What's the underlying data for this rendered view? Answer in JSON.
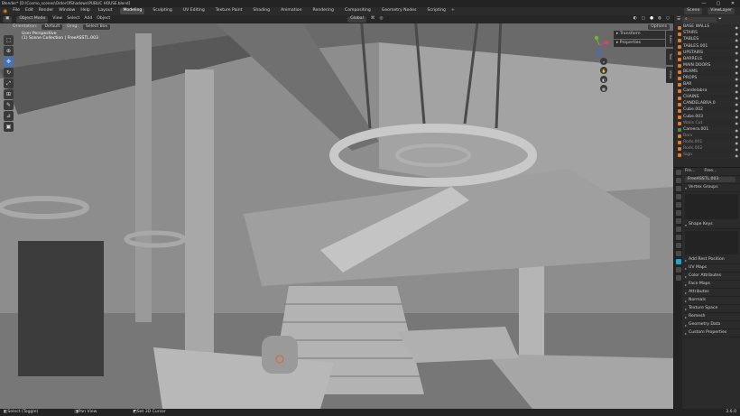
{
  "app": {
    "title": "Blender* [D:\\Cosmo_scenes\\OrderOfShadows\\PUBLIC HOUSE.blend]",
    "window_controls": [
      "—",
      "▢",
      "✕"
    ]
  },
  "menu": {
    "items": [
      "File",
      "Edit",
      "Render",
      "Window",
      "Help"
    ],
    "workspaces": [
      "Layout",
      "Modeling",
      "Sculpting",
      "UV Editing",
      "Texture Paint",
      "Shading",
      "Animation",
      "Rendering",
      "Compositing",
      "Geometry Nodes",
      "Scripting"
    ],
    "active_workspace": "Modeling",
    "scene": "Scene",
    "view_layer": "ViewLayer"
  },
  "viewport": {
    "mode": "Object Mode",
    "view_menus": [
      "View",
      "Select",
      "Add",
      "Object"
    ],
    "orientation": "Global",
    "sub": {
      "orientation_label": "Orientation:",
      "orientation_value": "Default",
      "drag_label": "Drag:",
      "drag_value": "Select Box",
      "options": "Options"
    },
    "info_line1": "User Perspective",
    "info_line2": "(1) Scene Collection | FreeASSTL.003"
  },
  "npanel": {
    "sections": [
      "Transform",
      "Properties"
    ],
    "tabs": [
      "Item",
      "Tool",
      "View"
    ]
  },
  "outliner": {
    "items": [
      {
        "name": "BASE WALLS",
        "type": "obj",
        "selected": false,
        "dim": false
      },
      {
        "name": "STAIRS",
        "type": "obj",
        "selected": false,
        "dim": false
      },
      {
        "name": "TABLES",
        "type": "obj",
        "selected": false,
        "dim": false
      },
      {
        "name": "TABLES.001",
        "type": "obj",
        "selected": false,
        "dim": false
      },
      {
        "name": "UPSTAIRS",
        "type": "obj",
        "selected": false,
        "dim": false
      },
      {
        "name": "BARRELS",
        "type": "obj",
        "selected": false,
        "dim": false
      },
      {
        "name": "MAIN DOORS",
        "type": "obj",
        "selected": false,
        "dim": false
      },
      {
        "name": "BEAMS",
        "type": "obj",
        "selected": false,
        "dim": false
      },
      {
        "name": "PROPS",
        "type": "obj",
        "selected": false,
        "dim": false
      },
      {
        "name": "BAR",
        "type": "obj",
        "selected": false,
        "dim": false
      },
      {
        "name": "Candelabra",
        "type": "obj",
        "selected": false,
        "dim": false
      },
      {
        "name": "CHAINS",
        "type": "obj",
        "selected": false,
        "dim": false
      },
      {
        "name": "CANDELABRA.0",
        "type": "obj",
        "selected": false,
        "dim": false
      },
      {
        "name": "Cube.002",
        "type": "obj",
        "selected": false,
        "dim": false
      },
      {
        "name": "Cube.003",
        "type": "obj",
        "selected": false,
        "dim": false
      },
      {
        "name": "Walls Cut",
        "type": "obj",
        "selected": false,
        "dim": true
      },
      {
        "name": "Camera.001",
        "type": "cam",
        "selected": false,
        "dim": false
      },
      {
        "name": "Bars",
        "type": "obj",
        "selected": false,
        "dim": true
      },
      {
        "name": "Rods.001",
        "type": "obj",
        "selected": false,
        "dim": true
      },
      {
        "name": "Rods.002",
        "type": "obj",
        "selected": false,
        "dim": true
      },
      {
        "name": "Sign",
        "type": "obj",
        "selected": false,
        "dim": true
      }
    ]
  },
  "properties": {
    "header_left": "Fre...",
    "header_right": "Free...",
    "object_name": "FreeASSTL.003",
    "sections": [
      {
        "label": "Vertex Groups",
        "open": true
      },
      {
        "label": "Shape Keys",
        "open": true
      },
      {
        "label": "Add Rest Position",
        "open": false
      },
      {
        "label": "UV Maps",
        "open": false
      },
      {
        "label": "Color Attributes",
        "open": false
      },
      {
        "label": "Face Maps",
        "open": false
      },
      {
        "label": "Attributes",
        "open": false
      },
      {
        "label": "Normals",
        "open": false
      },
      {
        "label": "Texture Space",
        "open": false
      },
      {
        "label": "Remesh",
        "open": false
      },
      {
        "label": "Geometry Data",
        "open": false
      },
      {
        "label": "Custom Properties",
        "open": false
      }
    ]
  },
  "statusbar": {
    "left": "Select (Toggle)",
    "mid1": "Pan View",
    "mid2": "Set 3D Cursor",
    "version": "3.6.0"
  },
  "colors": {
    "accent": "#4772b3",
    "selected_row": "#334b6e",
    "object_icon": "#e07a2c",
    "prop_active": "#20a4c8"
  }
}
